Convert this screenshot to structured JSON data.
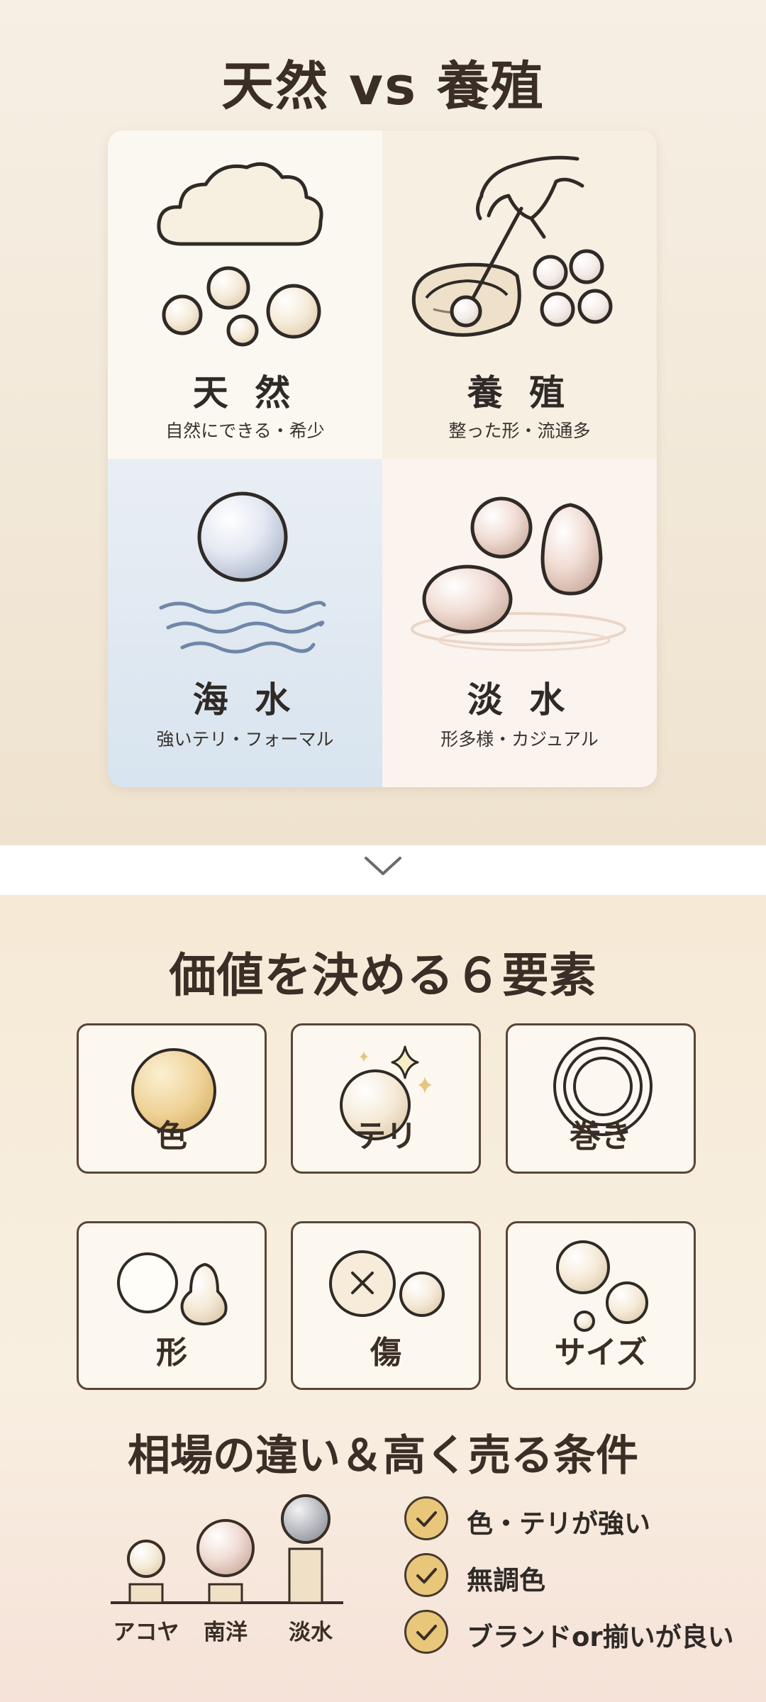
{
  "section1": {
    "title": "天然 vs 養殖",
    "cells": [
      {
        "name": "天 然",
        "desc": "自然にできる・希少",
        "icon": "cloud-pearls-icon"
      },
      {
        "name": "養 殖",
        "desc": "整った形・流通多",
        "icon": "oyster-hand-icon"
      },
      {
        "name": "海 水",
        "desc": "強いテリ・フォーマル",
        "icon": "pearl-waves-icon"
      },
      {
        "name": "淡 水",
        "desc": "形多様・カジュアル",
        "icon": "freshwater-pearls-icon"
      }
    ]
  },
  "divider": {
    "icon": "chevron-down-icon"
  },
  "section2": {
    "title": "価値を決める６要素",
    "factors": [
      {
        "label": "色",
        "icon": "gold-pearl-icon"
      },
      {
        "label": "テリ",
        "icon": "sparkle-pearl-icon"
      },
      {
        "label": "巻き",
        "icon": "concentric-rings-icon"
      },
      {
        "label": "形",
        "icon": "round-drop-shape-icon"
      },
      {
        "label": "傷",
        "icon": "flawed-pearl-icon"
      },
      {
        "label": "サイズ",
        "icon": "pearl-sizes-icon"
      }
    ]
  },
  "section3": {
    "title": "相場の違い＆高く売る条件",
    "bars": [
      "アコヤ",
      "南洋",
      "淡水"
    ],
    "checks": [
      "色・テリが強い",
      "無調色",
      "ブランドor揃いが良い"
    ]
  },
  "colors": {
    "accent": "#e9c77a",
    "ink": "#3a2e26",
    "sea": "#d8e4ef"
  }
}
